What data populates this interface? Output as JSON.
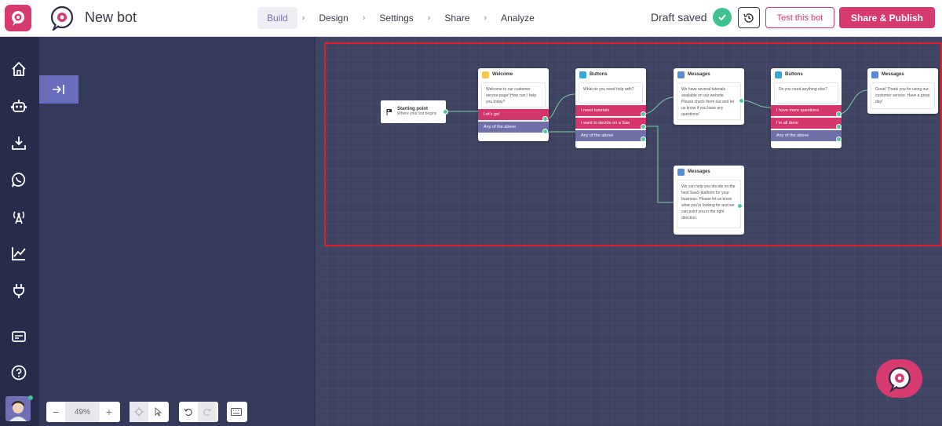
{
  "app": {
    "bot_title": "New bot"
  },
  "nav": {
    "tabs": [
      {
        "label": "Build",
        "active": true
      },
      {
        "label": "Design"
      },
      {
        "label": "Settings"
      },
      {
        "label": "Share"
      },
      {
        "label": "Analyze"
      }
    ],
    "separator": "›"
  },
  "header": {
    "status": "Draft saved",
    "test_label": "Test this bot",
    "publish_label": "Share & Publish"
  },
  "sidebar": {
    "items": [
      "home-icon",
      "bot-icon",
      "download-icon",
      "whatsapp-icon",
      "broadcast-icon",
      "analytics-icon",
      "plug-icon",
      "card-icon",
      "help-icon"
    ]
  },
  "flow": {
    "start": {
      "title": "Starting point",
      "subtitle": "Where your bot begins"
    },
    "nodes": [
      {
        "id": "welcome",
        "title": "Welcome",
        "text": "Welcome to our customer service page! How can I help you today?",
        "options": [
          "Let's go!",
          "Any of the above"
        ]
      },
      {
        "id": "buttons1",
        "title": "Buttons",
        "text": "What do you need help with?",
        "options": [
          "I need tutorials",
          "I want to decide on a Saa",
          "Any of the above"
        ]
      },
      {
        "id": "messages1",
        "title": "Messages",
        "text": "We have several tutorials available on our website. Please check them out and let us know if you have any questions!"
      },
      {
        "id": "buttons2",
        "title": "Buttons",
        "text": "Do you need anything else?",
        "options": [
          "I have more questions",
          "I'm all done",
          "Any of the above"
        ]
      },
      {
        "id": "messages2",
        "title": "Messages",
        "text": "Great! Thank you for using our customer service. Have a great day!"
      },
      {
        "id": "messages3",
        "title": "Messages",
        "text": "We can help you decide on the best SaaS platform for your business. Please let us know what you're looking for and we can point you in the right direction."
      }
    ]
  },
  "toolbar": {
    "zoom": "49%",
    "minus": "−",
    "plus": "+"
  },
  "colors": {
    "brand": "#d63a6f",
    "success": "#3ec28f",
    "accent": "#6f72b8"
  }
}
